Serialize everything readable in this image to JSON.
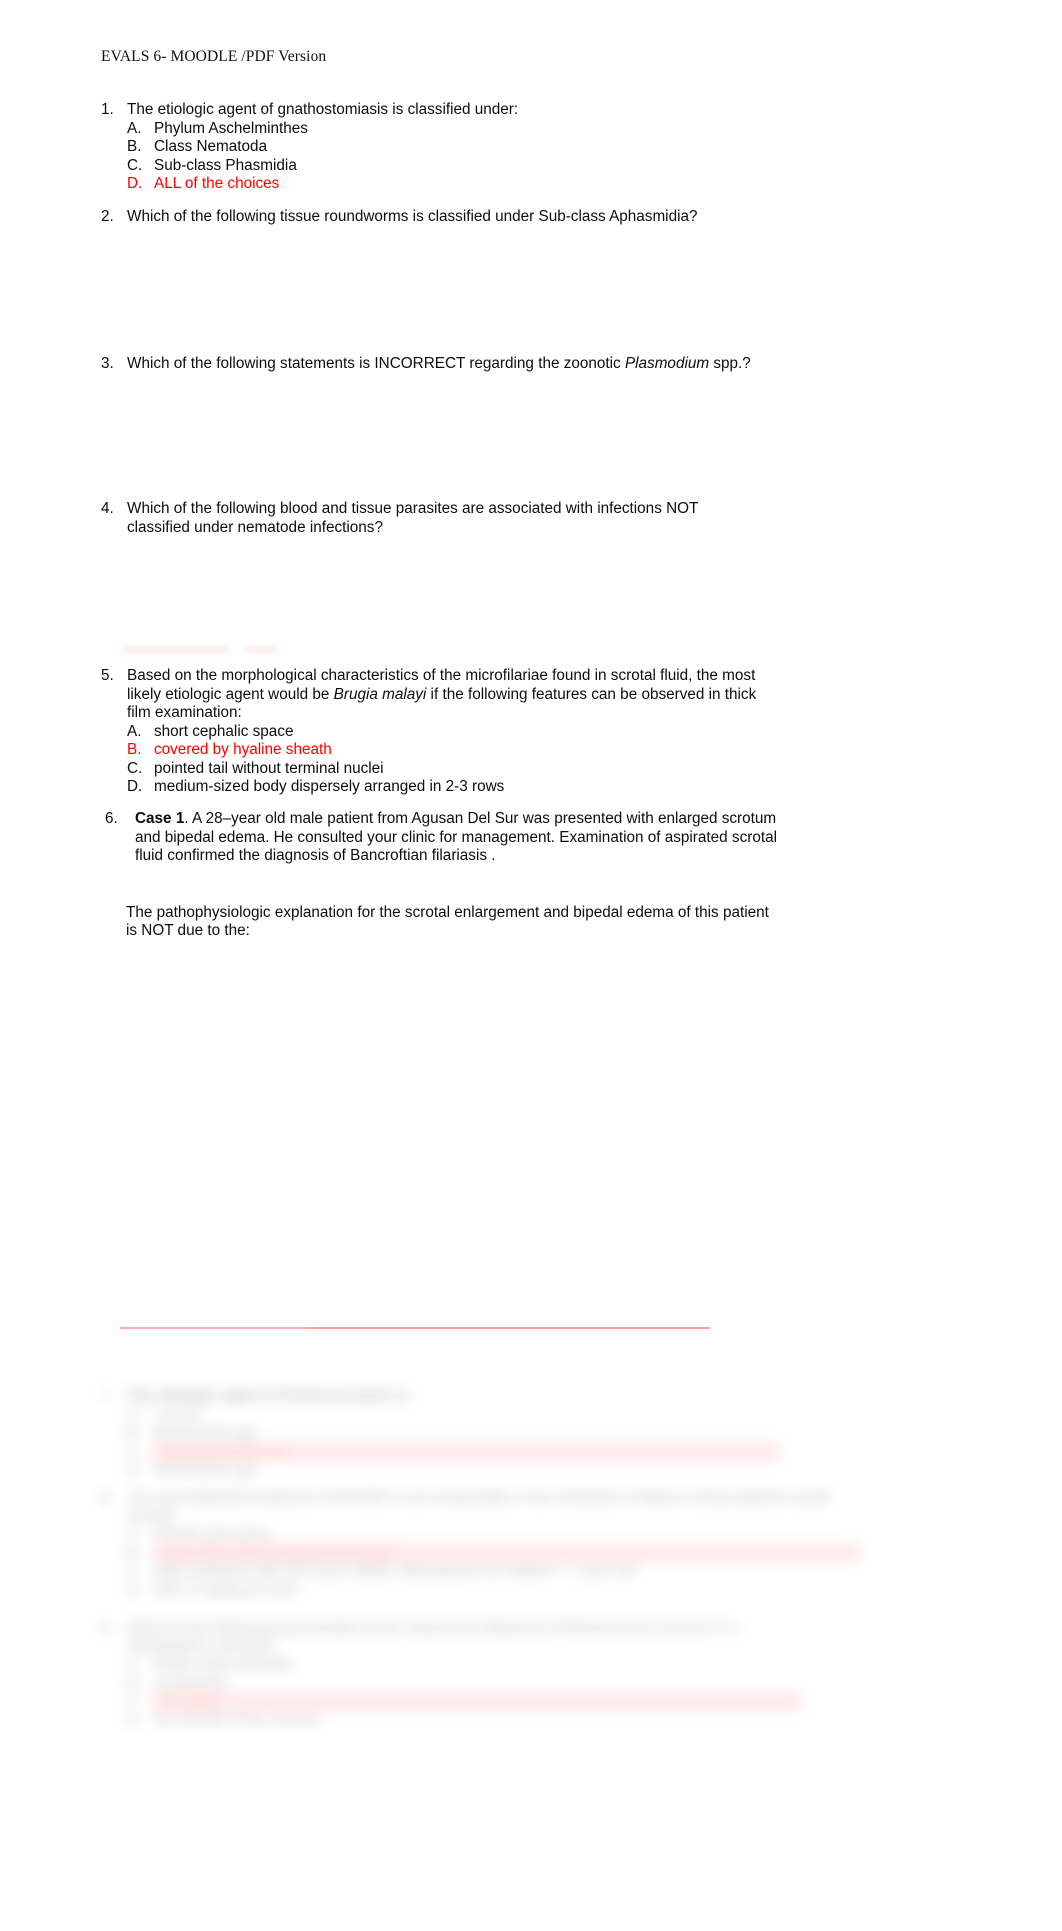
{
  "document": {
    "header": "EVALS 6- MOODLE /PDF Version"
  },
  "questions": [
    {
      "number": "1.",
      "text": "The etiologic agent of gnathostomiasis is classified under:",
      "choices": [
        {
          "letter": "A.",
          "text": "Phylum Aschelminthes",
          "answer": false
        },
        {
          "letter": "B.",
          "text": "Class Nematoda",
          "answer": false
        },
        {
          "letter": "C.",
          "text": "Sub-class Phasmidia",
          "answer": false
        },
        {
          "letter": "D.",
          "text": "ALL of the choices",
          "answer": true
        }
      ]
    },
    {
      "number": "2.",
      "text": "Which of the following tissue roundworms is classified under Sub-class Aphasmidia?",
      "choices": []
    },
    {
      "number": "3.",
      "text_part1": "Which of the following statements is INCORRECT regarding the zoonotic ",
      "text_italic": "Plasmodium",
      "text_part2": " spp.?",
      "choices": []
    },
    {
      "number": "4.",
      "text": "Which of the following blood and tissue parasites are associated with infections NOT classified under nematode infections?",
      "choices": []
    },
    {
      "number": "5.",
      "text_part1": "Based on the morphological characteristics  of the microfilariae found  in scrotal fluid, the most likely etiologic agent  would be ",
      "text_italic": "Brugia malayi",
      "text_part2": "  if the following features can be observed in thick film examination:",
      "choices": [
        {
          "letter": "A.",
          "text": "short cephalic space",
          "answer": false
        },
        {
          "letter": "B.",
          "text": "covered by hyaline sheath",
          "answer": true
        },
        {
          "letter": "C.",
          "text": "pointed tail without terminal nuclei",
          "answer": false
        },
        {
          "letter": "D.",
          "text": "medium-sized  body dispersely arranged in 2-3 rows",
          "answer": false
        }
      ]
    },
    {
      "number": "6.",
      "case_label": "Case 1",
      "text_after_label": ".  A 28–year old  male patient from Agusan Del Sur  was presented with enlarged scrotum  and  bipedal edema.  He  consulted your clinic for management.    Examination of aspirated scrotal fluid confirmed the diagnosis of  Bancroftian filariasis .",
      "follow_up": "The pathophysiologic explanation for the scrotal enlargement and bipedal edema of this patient  is NOT due to the:",
      "choices": []
    }
  ],
  "redacted_section": {
    "note": "blurred",
    "questions": [
      {
        "number": "7.",
        "text": "The etiologic agent of Onchocerciasis is:",
        "choices": [
          {
            "letter": "A.",
            "text": "Loa loa",
            "answer": false
          },
          {
            "letter": "B.",
            "text": "Mansonella spp.",
            "answer": false
          },
          {
            "letter": "C.",
            "text": "Onchocerca volvulus",
            "answer": true
          },
          {
            "letter": "D.",
            "text": "Wuchereria spp.",
            "answer": false
          }
        ]
      },
      {
        "number": "8.",
        "text": "The anti-wolbachia treatment of EITHER  a non-responsible            or the reinfection of filaria in these patients  would include:",
        "choices": [
          {
            "letter": "A.",
            "text": "Double dose drug",
            "answer": false
          },
          {
            "letter": "B.",
            "text": "doxycycline with a triple dose therapy",
            "answer": true
          },
          {
            "letter": "C.",
            "text": "daily treatment with  200 mg in adults, Albendazole for children < 1 year old",
            "answer": false
          },
          {
            "letter": "D.",
            "text": "DEC 6  mg/kg per year",
            "answer": false
          }
        ]
      },
      {
        "number": "9.",
        "text": "Which of the following   drug samples is/are required for diagnosis of filariasis from a known or a radiographic collected?",
        "choices": [
          {
            "letter": "A.",
            "text": "lymph node  aspirates",
            "answer": false
          },
          {
            "letter": "B.",
            "text": "scrotal fluid",
            "answer": false
          },
          {
            "letter": "C.",
            "text": "skin snips",
            "answer": true
          },
          {
            "letter": "D.",
            "text": "ALL/NONE of the choices",
            "answer": false
          }
        ]
      }
    ]
  }
}
